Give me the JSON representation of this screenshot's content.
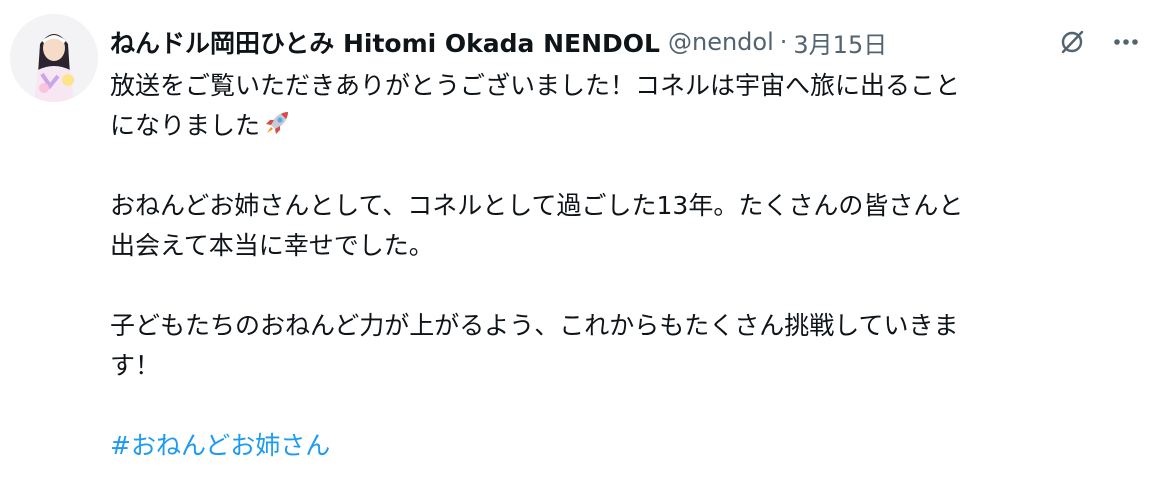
{
  "author": {
    "display_name": "ねんドル岡田ひとみ Hitomi Okada NENDOL",
    "handle": "@nendol",
    "separator": "·",
    "date": "3月15日"
  },
  "icons": {
    "grok": "grok-icon",
    "more": "more-icon",
    "rocket": "rocket-emoji-icon"
  },
  "tweet": {
    "line1": "放送をご覧いただきありがとうございました！コネルは宇宙へ旅に出ること",
    "line2": "になりました",
    "line3": "おねんどお姉さんとして、コネルとして過ごした13年。たくさんの皆さんと",
    "line4": "出会えて本当に幸せでした。",
    "line5": "子どもたちのおねんど力が上がるよう、これからもたくさん挑戦していきま",
    "line6": "す！",
    "hashtag": "#おねんどお姉さん"
  },
  "colors": {
    "text": "#0f1419",
    "secondary": "#536471",
    "link": "#1d9bf0"
  }
}
